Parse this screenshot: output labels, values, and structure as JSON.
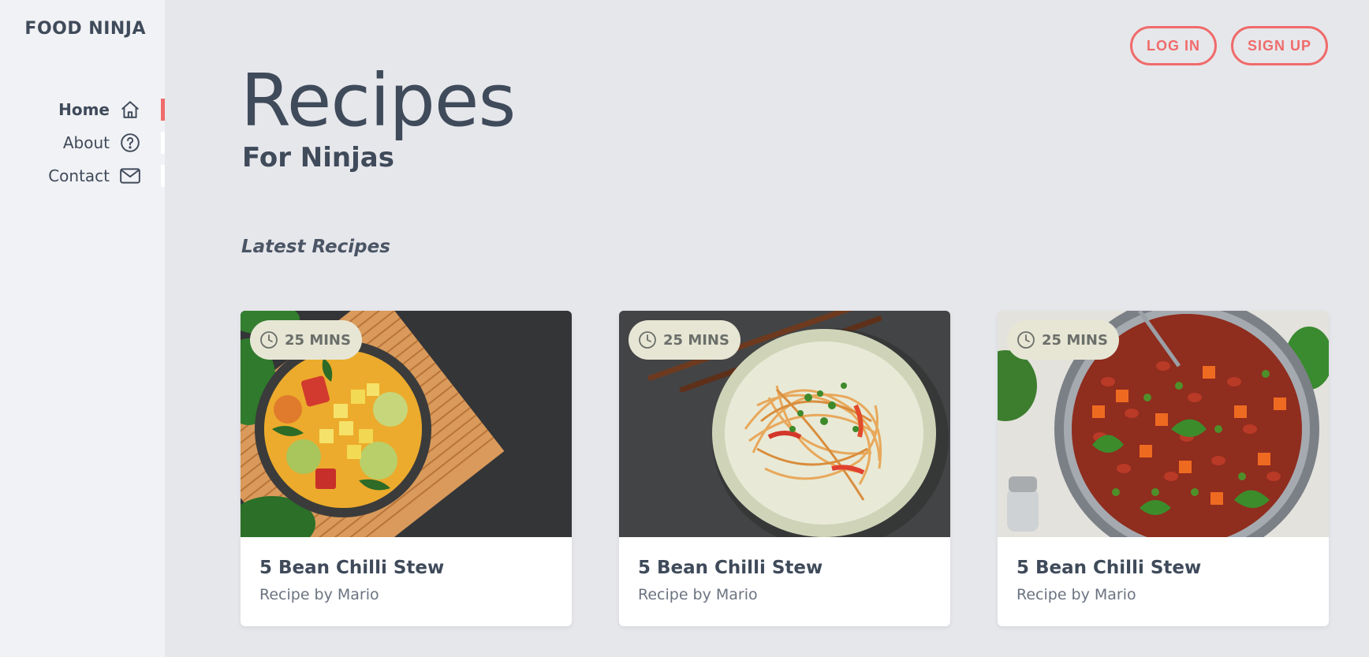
{
  "brand": {
    "name": "FOOD NINJA"
  },
  "nav": {
    "items": [
      {
        "label": "Home",
        "icon": "home-icon",
        "active": true
      },
      {
        "label": "About",
        "icon": "question-circle-icon",
        "active": false
      },
      {
        "label": "Contact",
        "icon": "mail-icon",
        "active": false
      }
    ]
  },
  "auth": {
    "login_label": "LOG IN",
    "signup_label": "SIGN UP"
  },
  "hero": {
    "title": "Recipes",
    "subtitle": "For Ninjas"
  },
  "section": {
    "title": "Latest Recipes"
  },
  "recipes": [
    {
      "time": "25 MINS",
      "title": "5 Bean Chilli Stew",
      "author": "Recipe by Mario",
      "image": "curry-bowl"
    },
    {
      "time": "25 MINS",
      "title": "5 Bean Chilli Stew",
      "author": "Recipe by Mario",
      "image": "noodle-bowl"
    },
    {
      "time": "25 MINS",
      "title": "5 Bean Chilli Stew",
      "author": "Recipe by Mario",
      "image": "bean-stew-pan"
    }
  ],
  "colors": {
    "accent": "#f06b6b",
    "sidebar_bg": "#f1f2f5",
    "main_bg": "#e6e7eb",
    "text": "#3f4a5a",
    "badge_bg": "#e7e6d5"
  }
}
